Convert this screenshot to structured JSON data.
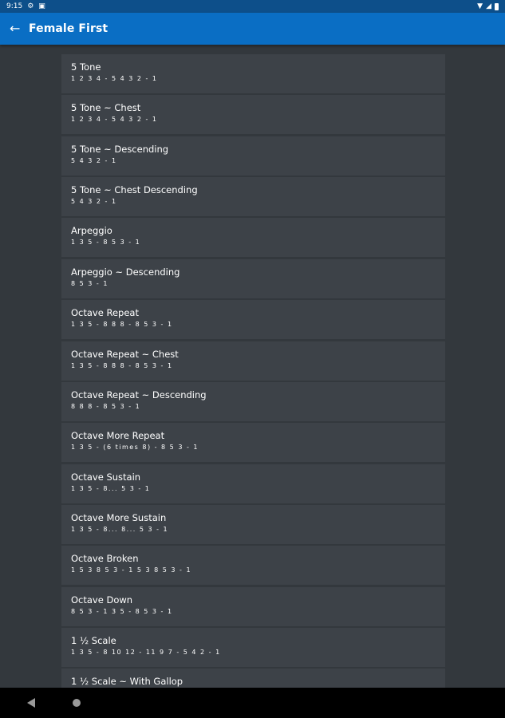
{
  "status_bar": {
    "time": "9:15",
    "icons": [
      "gear-icon",
      "notification-icon",
      "wifi-icon",
      "signal-icon",
      "battery-icon"
    ]
  },
  "app_bar": {
    "title": "Female First",
    "back_icon": "arrow-left-icon"
  },
  "colors": {
    "app_bar": "#0a6ec4",
    "status_bar": "#0d4f8a",
    "background": "#33383d",
    "list_item": "#3d4248",
    "text": "#ffffff"
  },
  "list": {
    "items": [
      {
        "title": "5 Tone",
        "pattern": "1 2 3 4 - 5 4 3 2 - 1"
      },
      {
        "title": "5 Tone ~ Chest",
        "pattern": "1 2 3 4 - 5 4 3 2 - 1"
      },
      {
        "title": "5 Tone ~ Descending",
        "pattern": "5 4 3 2 - 1"
      },
      {
        "title": "5 Tone ~ Chest Descending",
        "pattern": "5 4 3 2 - 1"
      },
      {
        "title": "Arpeggio",
        "pattern": "1 3 5 - 8 5 3 - 1"
      },
      {
        "title": "Arpeggio ~ Descending",
        "pattern": "8 5 3 - 1"
      },
      {
        "title": "Octave Repeat",
        "pattern": "1 3 5 - 8 8 8 - 8 5 3 - 1"
      },
      {
        "title": "Octave Repeat ~ Chest",
        "pattern": "1 3 5 - 8 8 8 - 8 5 3 - 1"
      },
      {
        "title": "Octave Repeat ~ Descending",
        "pattern": "8 8 8 - 8 5 3 - 1"
      },
      {
        "title": "Octave More Repeat",
        "pattern": "1 3 5 - (6 times 8) - 8 5 3 - 1"
      },
      {
        "title": "Octave Sustain",
        "pattern": "1 3 5 - 8... 5 3 - 1"
      },
      {
        "title": "Octave More Sustain",
        "pattern": "1 3 5 - 8... 8... 5 3 - 1"
      },
      {
        "title": "Octave Broken",
        "pattern": "1 5 3 8 5 3 - 1 5 3 8 5 3 - 1"
      },
      {
        "title": "Octave Down",
        "pattern": "8 5 3 - 1 3 5 - 8 5 3 - 1"
      },
      {
        "title": "1 ½ Scale",
        "pattern": "1 3 5 - 8 10 12 - 11 9 7 - 5 4 2 - 1"
      },
      {
        "title": "1 ½ Scale ~ With Gallop",
        "pattern": ""
      }
    ]
  },
  "nav_bar": {
    "icons": [
      "nav-back-icon",
      "nav-home-icon"
    ]
  }
}
